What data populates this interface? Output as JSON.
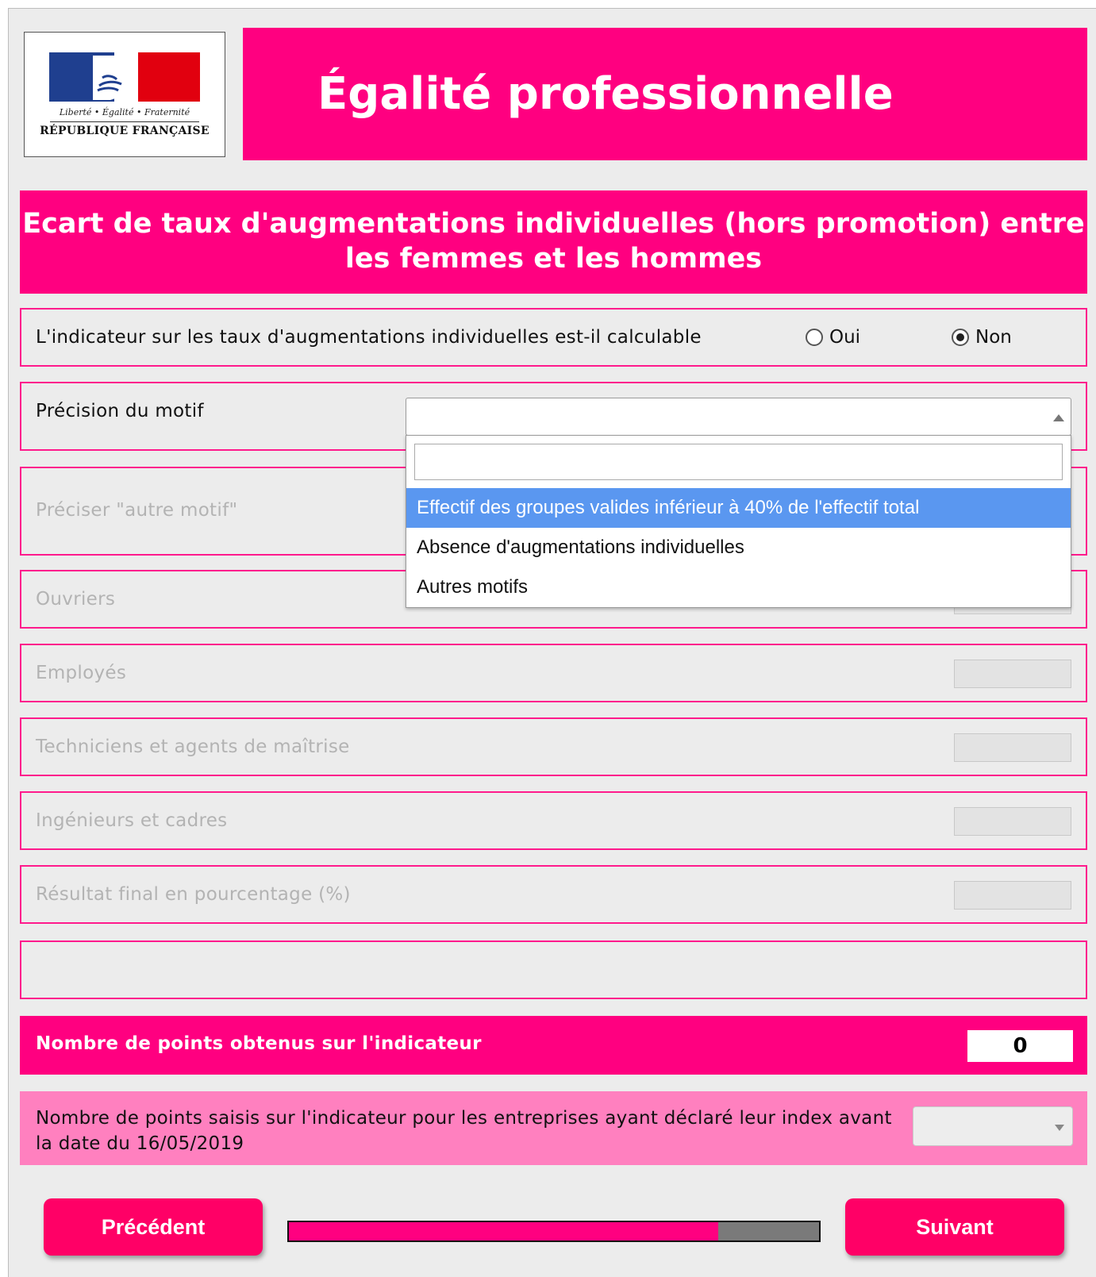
{
  "logo": {
    "motto": "Liberté • Égalité • Fraternité",
    "republic": "RÉPUBLIQUE FRANÇAISE"
  },
  "header": {
    "title": "Égalité professionnelle"
  },
  "section": {
    "title": "Ecart de taux d'augmentations individuelles (hors promotion) entre les femmes et les hommes"
  },
  "calculable": {
    "label": "L'indicateur sur les taux d'augmentations individuelles est-il calculable",
    "options": [
      {
        "label": "Oui",
        "selected": false
      },
      {
        "label": "Non",
        "selected": true
      }
    ]
  },
  "motif": {
    "label": "Précision du motif",
    "value": "",
    "search_value": "",
    "options": [
      {
        "label": "Effectif des groupes valides inférieur à 40% de l'effectif total",
        "highlighted": true
      },
      {
        "label": "Absence d'augmentations individuelles",
        "highlighted": false
      },
      {
        "label": "Autres motifs",
        "highlighted": false
      }
    ]
  },
  "autre_motif": {
    "label": "Préciser \"autre motif\""
  },
  "categories": [
    {
      "label": "Ouvriers",
      "value": ""
    },
    {
      "label": "Employés",
      "value": ""
    },
    {
      "label": "Techniciens et agents de maîtrise",
      "value": ""
    },
    {
      "label": "Ingénieurs et cadres",
      "value": ""
    },
    {
      "label": "Résultat final en pourcentage (%)",
      "value": ""
    }
  ],
  "points": {
    "label": "Nombre de points obtenus sur l'indicateur",
    "value": "0"
  },
  "saisis": {
    "label": "Nombre de points saisis sur l'indicateur pour les entreprises ayant déclaré leur index avant la date du 16/05/2019",
    "value": ""
  },
  "nav": {
    "prev_label": "Précédent",
    "next_label": "Suivant",
    "progress": 0.81
  },
  "colors": {
    "accent": "#ff0080",
    "accent_light": "#ff80bf",
    "button": "#ff0066",
    "dropdown_highlight": "#5a97f0"
  }
}
